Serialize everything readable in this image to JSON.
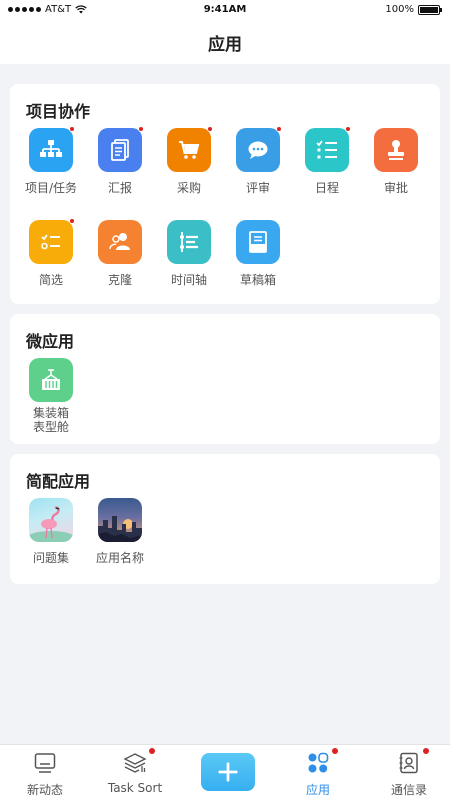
{
  "status_bar": {
    "carrier": "AT&T",
    "time": "9:41AM",
    "battery": "100%"
  },
  "nav": {
    "title": "应用"
  },
  "sections": {
    "collab": {
      "title": "项目协作",
      "apps": [
        {
          "label": "项目/任务",
          "icon": "org-chart-icon",
          "color": "#2ba3f3",
          "badge": true
        },
        {
          "label": "汇报",
          "icon": "documents-icon",
          "color": "#4a7ff0",
          "badge": true
        },
        {
          "label": "采购",
          "icon": "shopping-cart-icon",
          "color": "#f08200",
          "badge": true
        },
        {
          "label": "评审",
          "icon": "chat-bubble-icon",
          "color": "#3a9ee6",
          "badge": true
        },
        {
          "label": "日程",
          "icon": "checklist-icon",
          "color": "#2bc6c7",
          "badge": true
        },
        {
          "label": "审批",
          "icon": "stamp-icon",
          "color": "#f36d3e",
          "badge": false
        },
        {
          "label": "简选",
          "icon": "select-list-icon",
          "color": "#f7ac0a",
          "badge": true
        },
        {
          "label": "克隆",
          "icon": "clone-users-icon",
          "color": "#f58230",
          "badge": false
        },
        {
          "label": "时间轴",
          "icon": "timeline-icon",
          "color": "#3cbec6",
          "badge": false
        },
        {
          "label": "草稿箱",
          "icon": "draft-box-icon",
          "color": "#3aa8f0",
          "badge": false
        }
      ]
    },
    "micro": {
      "title": "微应用",
      "apps": [
        {
          "label_line1": "集装箱",
          "label_line2": "表型舱",
          "icon": "container-icon",
          "color": "#5ed08c"
        }
      ]
    },
    "simple": {
      "title": "简配应用",
      "apps": [
        {
          "label": "问题集",
          "icon": "flamingo-image-icon"
        },
        {
          "label": "应用名称",
          "icon": "city-dusk-image-icon"
        }
      ]
    }
  },
  "tab_bar": {
    "items": [
      {
        "label": "新动态",
        "icon": "monitor-icon",
        "badge": false
      },
      {
        "label": "Task Sort",
        "icon": "layers-icon",
        "badge": true
      },
      {
        "label": "",
        "icon": "plus-icon"
      },
      {
        "label": "应用",
        "icon": "apps-grid-icon",
        "badge": true,
        "active": true
      },
      {
        "label": "通信录",
        "icon": "contacts-book-icon",
        "badge": true
      }
    ],
    "active_color": "#2f8fe8"
  }
}
